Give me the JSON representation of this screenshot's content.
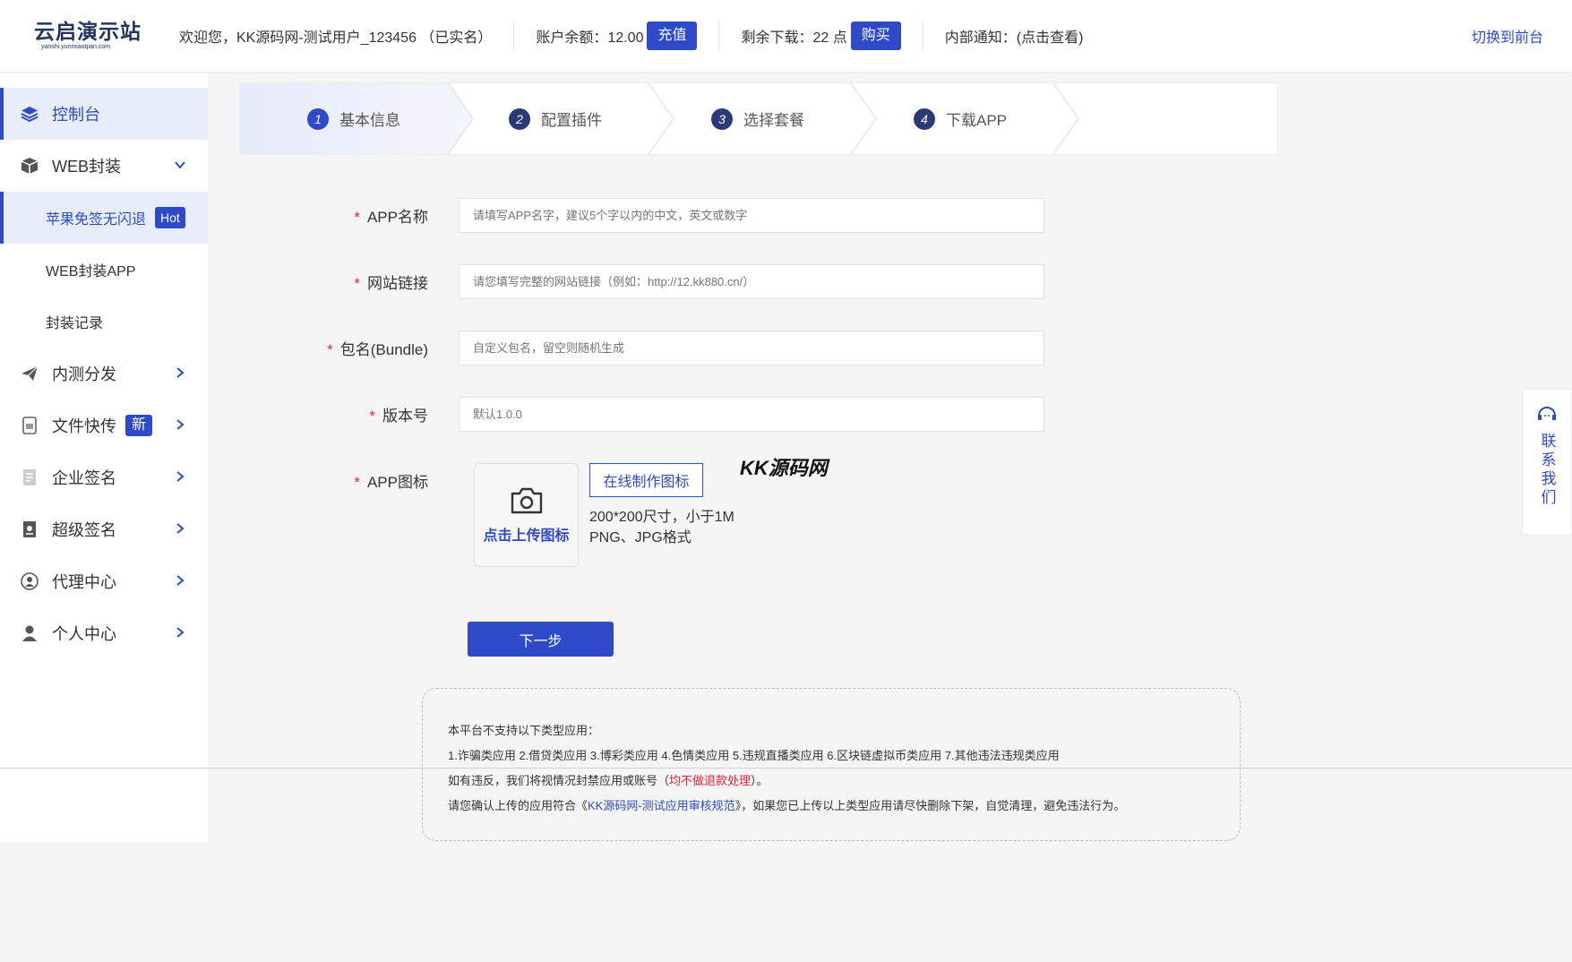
{
  "header": {
    "logo_main": "云启演示站",
    "logo_sub": "yanshi.yunmiaoqian.com",
    "welcome": "欢迎您，KK源码网-测试用户_123456 （已实名）",
    "balance_label": "账户余额：12.00",
    "recharge_button": "充值",
    "downloads_label": "剩余下载：22 点",
    "buy_button": "购买",
    "notice": "内部通知：(点击查看)",
    "switch_front": "切换到前台"
  },
  "sidebar": {
    "dashboard": "控制台",
    "web_wrap": "WEB封装",
    "sub_apple": "苹果免签无闪退",
    "badge_hot": "Hot",
    "sub_web_app": "WEB封装APP",
    "sub_records": "封装记录",
    "beta_dist": "内测分发",
    "file_transfer": "文件快传",
    "badge_new": "新",
    "enterprise_sign": "企业签名",
    "super_sign": "超级签名",
    "agent_center": "代理中心",
    "personal_center": "个人中心"
  },
  "steps": [
    {
      "num": "1",
      "label": "基本信息"
    },
    {
      "num": "2",
      "label": "配置插件"
    },
    {
      "num": "3",
      "label": "选择套餐"
    },
    {
      "num": "4",
      "label": "下载APP"
    }
  ],
  "form": {
    "app_name_label": "APP名称",
    "app_name_placeholder": "请填写APP名字，建议5个字以内的中文，英文或数字",
    "site_label": "网站链接",
    "site_placeholder": "请您填写完整的网站链接（例如：http://12.kk880.cn/）",
    "bundle_label": "包名(Bundle)",
    "bundle_placeholder": "自定义包名，留空则随机生成",
    "version_label": "版本号",
    "version_placeholder": "默认1.0.0",
    "icon_label": "APP图标",
    "upload_text": "点击上传图标",
    "make_icon_button": "在线制作图标",
    "hint_size": "200*200尺寸，小于1M",
    "hint_format": "PNG、JPG格式",
    "watermark": "KK源码网",
    "next_button": "下一步",
    "required_mark": "*"
  },
  "notice": {
    "line1": "本平台不支持以下类型应用：",
    "line2": "1.诈骗类应用 2.借贷类应用 3.博彩类应用 4.色情类应用 5.违规直播类应用 6.区块链虚拟币类应用 7.其他违法违规类应用",
    "line3_prefix": "如有违反，我们将视情况封禁应用或账号（",
    "line3_red": "均不做退款处理",
    "line3_suffix": "）。",
    "line4_prefix": "请您确认上传的应用符合《",
    "line4_link": "KK源码网-测试应用审核规范",
    "line4_suffix": "》，如果您已上传以上类型应用请尽快删除下架，自觉清理，避免违法行为。"
  },
  "contact": {
    "label": "联系我们"
  },
  "colors": {
    "primary": "#2f4ac8",
    "required": "#ee2233",
    "logo": "#22355f"
  }
}
